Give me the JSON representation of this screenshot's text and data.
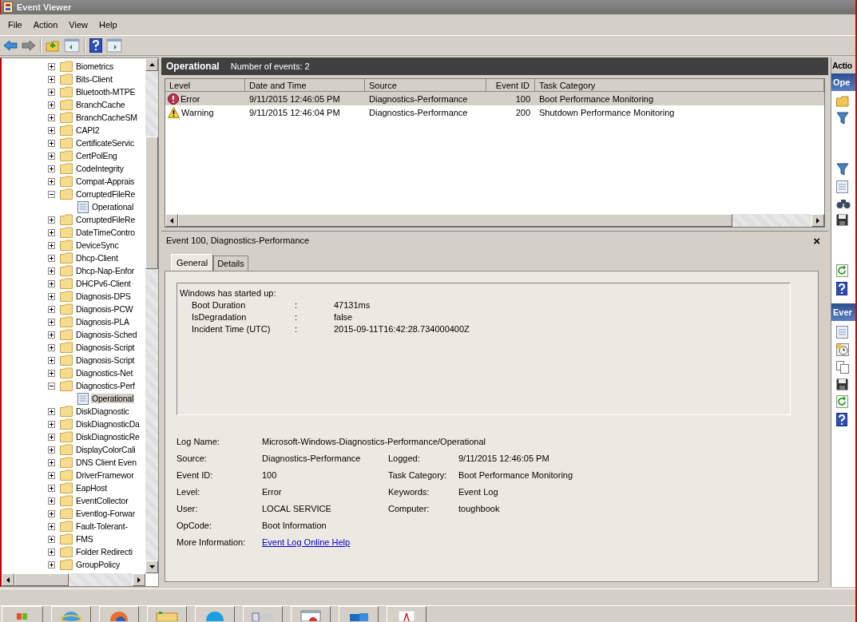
{
  "window": {
    "title": "Event Viewer"
  },
  "menu": [
    "File",
    "Action",
    "View",
    "Help"
  ],
  "tree": [
    {
      "name": "Biometrics",
      "expanded": false
    },
    {
      "name": "Bits-Client",
      "expanded": false
    },
    {
      "name": "Bluetooth-MTPE",
      "expanded": false
    },
    {
      "name": "BranchCache",
      "expanded": false
    },
    {
      "name": "BranchCacheSM",
      "expanded": false
    },
    {
      "name": "CAPI2",
      "expanded": false
    },
    {
      "name": "CertificateServic",
      "expanded": false
    },
    {
      "name": "CertPolEng",
      "expanded": false
    },
    {
      "name": "CodeIntegrity",
      "expanded": false
    },
    {
      "name": "Compat-Apprais",
      "expanded": false
    },
    {
      "name": "CorruptedFileRe",
      "expanded": true,
      "children": [
        {
          "name": "Operational",
          "selected": false
        }
      ]
    },
    {
      "name": "CorruptedFileRe",
      "expanded": false
    },
    {
      "name": "DateTimeContro",
      "expanded": false
    },
    {
      "name": "DeviceSync",
      "expanded": false
    },
    {
      "name": "Dhcp-Client",
      "expanded": false
    },
    {
      "name": "Dhcp-Nap-Enfor",
      "expanded": false
    },
    {
      "name": "DHCPv6-Client",
      "expanded": false
    },
    {
      "name": "Diagnosis-DPS",
      "expanded": false
    },
    {
      "name": "Diagnosis-PCW",
      "expanded": false
    },
    {
      "name": "Diagnosis-PLA",
      "expanded": false
    },
    {
      "name": "Diagnosis-Sched",
      "expanded": false
    },
    {
      "name": "Diagnosis-Script",
      "expanded": false
    },
    {
      "name": "Diagnosis-Script",
      "expanded": false
    },
    {
      "name": "Diagnostics-Net",
      "expanded": false
    },
    {
      "name": "Diagnostics-Perf",
      "expanded": true,
      "children": [
        {
          "name": "Operational",
          "selected": true
        }
      ]
    },
    {
      "name": "DiskDiagnostic",
      "expanded": false
    },
    {
      "name": "DiskDiagnosticDa",
      "expanded": false
    },
    {
      "name": "DiskDiagnosticRe",
      "expanded": false
    },
    {
      "name": "DisplayColorCali",
      "expanded": false
    },
    {
      "name": "DNS Client Even",
      "expanded": false
    },
    {
      "name": "DriverFramewor",
      "expanded": false
    },
    {
      "name": "EapHost",
      "expanded": false
    },
    {
      "name": "EventCollector",
      "expanded": false
    },
    {
      "name": "Eventlog-Forwar",
      "expanded": false
    },
    {
      "name": "Fault-Tolerant-",
      "expanded": false
    },
    {
      "name": "FMS",
      "expanded": false
    },
    {
      "name": "Folder Redirecti",
      "expanded": false
    },
    {
      "name": "GroupPolicy",
      "expanded": false
    }
  ],
  "log_header": {
    "title": "Operational",
    "count": "Number of events: 2"
  },
  "table": {
    "columns": [
      "Level",
      "Date and Time",
      "Source",
      "Event ID",
      "Task Category"
    ],
    "rows": [
      {
        "kind": "error",
        "level": "Error",
        "date": "9/11/2015 12:46:05 PM",
        "source": "Diagnostics-Performance",
        "event_id": "100",
        "task": "Boot Performance Monitoring",
        "selected": true
      },
      {
        "kind": "warning",
        "level": "Warning",
        "date": "9/11/2015 12:46:04 PM",
        "source": "Diagnostics-Performance",
        "event_id": "200",
        "task": "Shutdown Performance Monitoring",
        "selected": false
      }
    ]
  },
  "detail": {
    "title": "Event 100, Diagnostics-Performance",
    "close": "×",
    "tabs": [
      {
        "label": "General",
        "selected": true
      },
      {
        "label": "Details",
        "selected": false
      }
    ],
    "description": {
      "intro": "Windows has started up:",
      "lines": [
        {
          "label": "Boot Duration",
          "sep": ":",
          "value": "47131ms"
        },
        {
          "label": "IsDegradation",
          "sep": ":",
          "value": "false"
        },
        {
          "label": "Incident Time (UTC)",
          "sep": ":",
          "value": "2015-09-11T16:42:28.734000400Z"
        }
      ]
    },
    "properties": [
      {
        "kind": "wide",
        "label": "Log Name:",
        "value": "Microsoft-Windows-Diagnostics-Performance/Operational"
      },
      {
        "kind": "pair",
        "label": "Source:",
        "value": "Diagnostics-Performance",
        "label2": "Logged:",
        "value2": "9/11/2015 12:46:05 PM"
      },
      {
        "kind": "pair",
        "label": "Event ID:",
        "value": "100",
        "label2": "Task Category:",
        "value2": "Boot Performance Monitoring"
      },
      {
        "kind": "pair",
        "label": "Level:",
        "value": "Error",
        "label2": "Keywords:",
        "value2": "Event Log"
      },
      {
        "kind": "pair",
        "label": "User:",
        "value": "LOCAL SERVICE",
        "label2": "Computer:",
        "value2": "toughbook"
      },
      {
        "kind": "wide",
        "label": "OpCode:",
        "value": "Boot Information"
      },
      {
        "kind": "link",
        "label": "More Information:",
        "value": "Event Log Online Help"
      }
    ]
  },
  "actions": {
    "title": "Actio",
    "sections": [
      "Ope",
      "Ever"
    ]
  }
}
